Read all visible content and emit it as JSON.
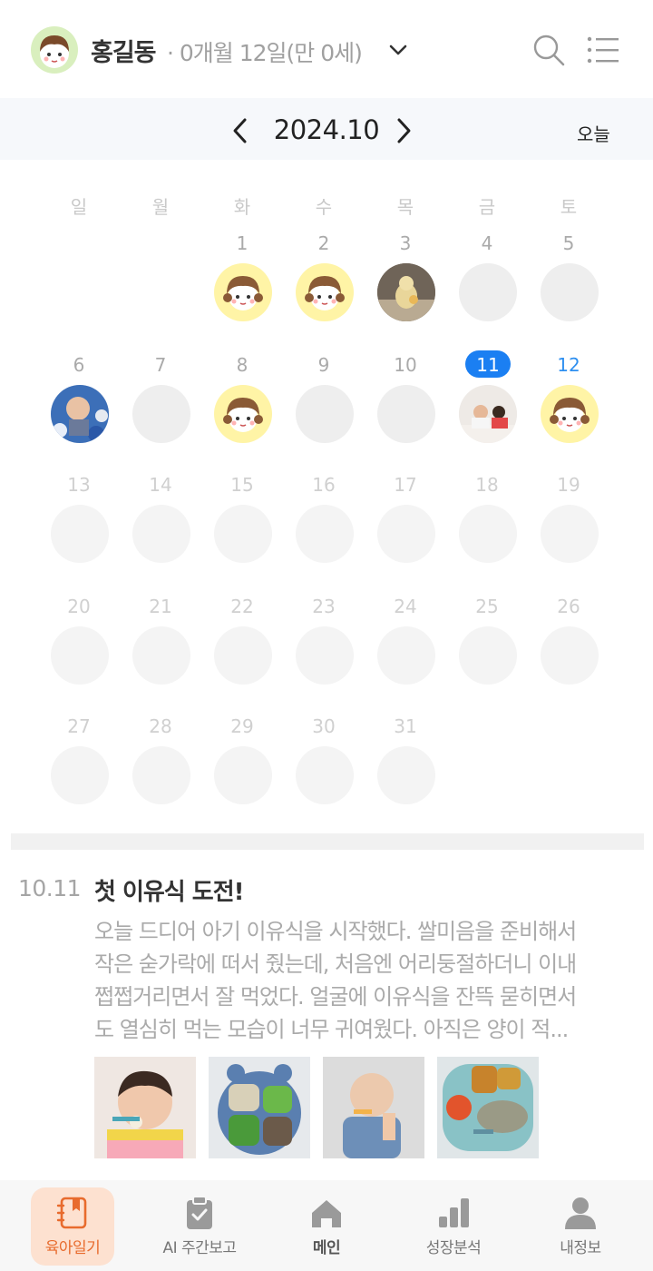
{
  "header": {
    "name": "홍길동",
    "age": "· 0개월 12일(만 0세)"
  },
  "calendar": {
    "month": "2024.10",
    "today_label": "오늘",
    "weekdays": [
      "일",
      "월",
      "화",
      "수",
      "목",
      "금",
      "토"
    ],
    "days": [
      "1",
      "2",
      "3",
      "4",
      "5",
      "6",
      "7",
      "8",
      "9",
      "10",
      "11",
      "12",
      "13",
      "14",
      "15",
      "16",
      "17",
      "18",
      "19",
      "20",
      "21",
      "22",
      "23",
      "24",
      "25",
      "26",
      "27",
      "28",
      "29",
      "30",
      "31"
    ],
    "selected_day": "11",
    "today": "12"
  },
  "entry": {
    "date": "10.11",
    "title": "첫 이유식 도전!",
    "body_lines": [
      "오늘 드디어 아기 이유식을 시작했다. 쌀미음을 준비해서",
      "작은 숟가락에 떠서 줬는데, 처음엔 어리둥절하더니 이내",
      "쩝쩝거리면서 잘 먹었다. 얼굴에 이유식을 잔뜩 묻히면서",
      "도 열심히 먹는 모습이 너무 귀여웠다. 아직은 양이 적..."
    ]
  },
  "nav": {
    "items": [
      {
        "label": "육아일기",
        "icon": "diary-icon"
      },
      {
        "label": "AI 주간보고",
        "icon": "clipboard-icon"
      },
      {
        "label": "메인",
        "icon": "home-icon"
      },
      {
        "label": "성장분석",
        "icon": "bar-chart-icon"
      },
      {
        "label": "내정보",
        "icon": "person-icon"
      }
    ]
  },
  "colors": {
    "accent_blue": "#1b7ff2",
    "accent_orange": "#e86b2d",
    "face_yellow": "#fff4a6"
  }
}
